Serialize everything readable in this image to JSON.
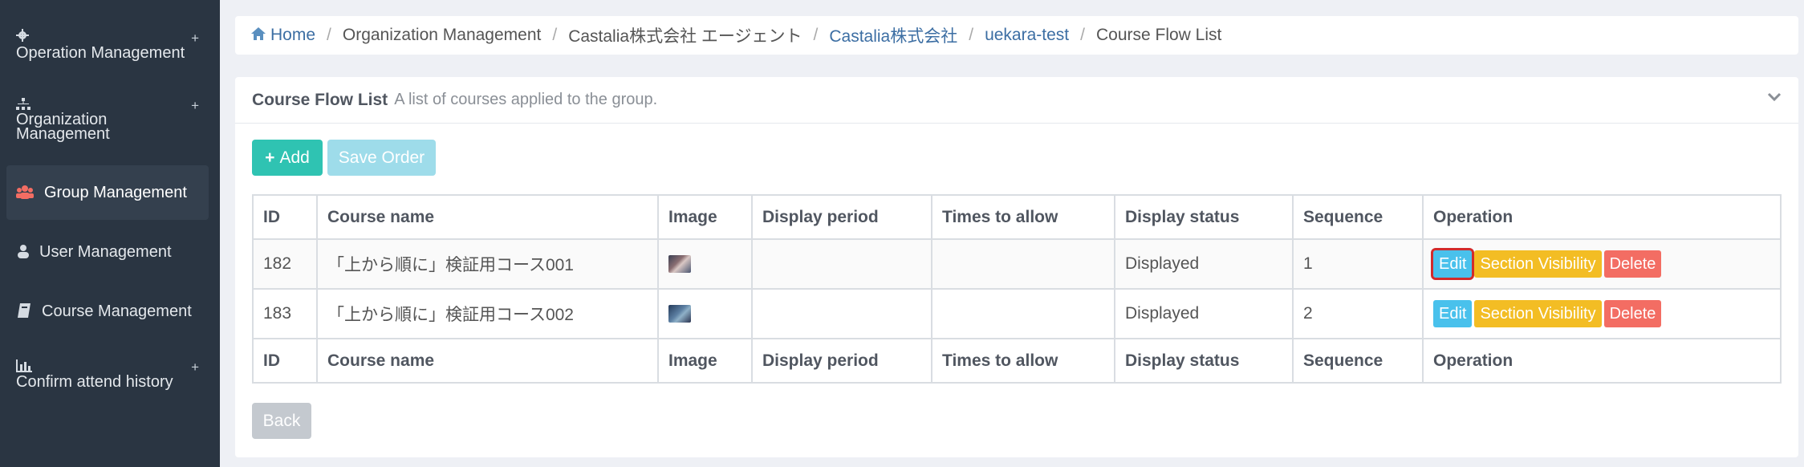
{
  "sidebar": {
    "items": [
      {
        "label": "Operation Management",
        "icon": "gear-icon",
        "expandable": true
      },
      {
        "label": "Organization\nManagement",
        "icon": "sitemap-icon",
        "expandable": true
      },
      {
        "label": "Group Management",
        "icon": "users-icon",
        "active": true
      },
      {
        "label": "User Management",
        "icon": "user-icon"
      },
      {
        "label": "Course Management",
        "icon": "book-icon"
      },
      {
        "label": "Confirm attend history",
        "icon": "bar-chart-icon",
        "expandable": true
      }
    ],
    "plus": "+"
  },
  "breadcrumb": {
    "home": "Home",
    "items": [
      "Organization Management",
      "Castalia株式会社 エージェント",
      "Castalia株式会社",
      "uekara-test",
      "Course Flow List"
    ]
  },
  "panel": {
    "title": "Course Flow List",
    "subtitle": "A list of courses applied to the group."
  },
  "buttons": {
    "add": "Add",
    "save_order": "Save Order",
    "back": "Back"
  },
  "table": {
    "headers": [
      "ID",
      "Course name",
      "Image",
      "Display period",
      "Times to allow",
      "Display status",
      "Sequence",
      "Operation"
    ],
    "rows": [
      {
        "id": "182",
        "name": "「上から順に」検証用コース001",
        "period": "",
        "times": "",
        "status": "Displayed",
        "sequence": "1"
      },
      {
        "id": "183",
        "name": "「上から順に」検証用コース002",
        "period": "",
        "times": "",
        "status": "Displayed",
        "sequence": "2"
      }
    ],
    "ops": {
      "edit": "Edit",
      "visibility": "Section Visibility",
      "delete": "Delete"
    }
  },
  "colors": {
    "sidebar_bg": "#2a3542",
    "add": "#2fc3b2",
    "save_order": "#9edcea",
    "edit": "#49c1ec",
    "visibility": "#f3bd24",
    "delete": "#f36d63",
    "highlight": "#d22b2b"
  }
}
